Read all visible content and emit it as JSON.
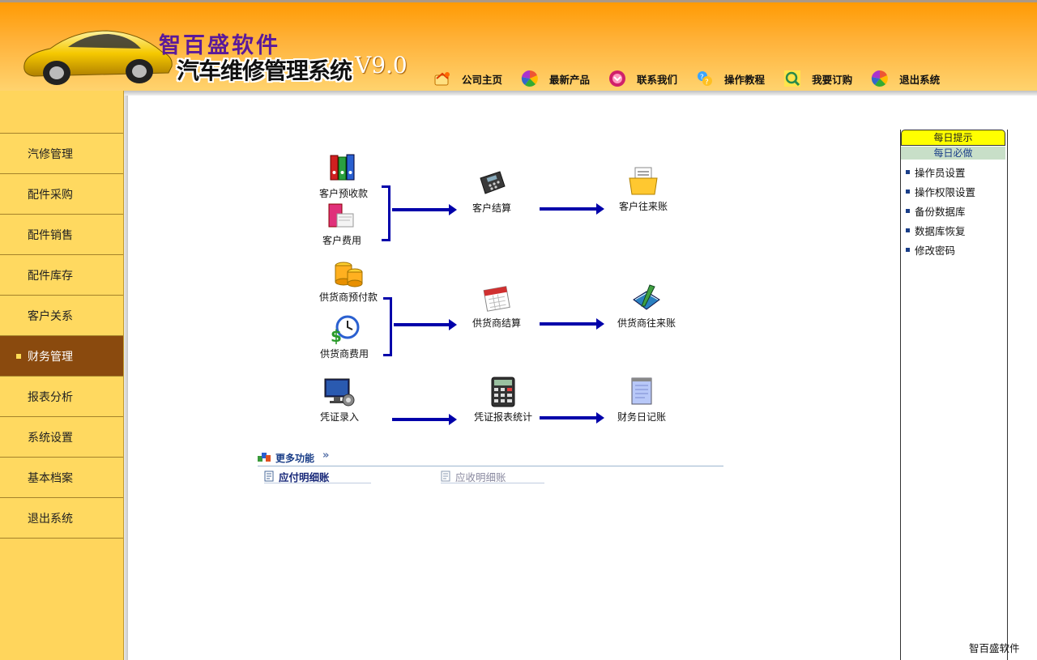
{
  "header": {
    "brand": "智百盛软件",
    "product": "汽车维修管理系统",
    "version": "V9.0",
    "nav": [
      {
        "label": "公司主页",
        "icon": "home-icon"
      },
      {
        "label": "最新产品",
        "icon": "pinwheel-icon"
      },
      {
        "label": "联系我们",
        "icon": "contact-icon"
      },
      {
        "label": "操作教程",
        "icon": "tutorial-icon"
      },
      {
        "label": "我要订购",
        "icon": "order-icon"
      },
      {
        "label": "退出系统",
        "icon": "exit-icon"
      }
    ]
  },
  "sidebar": {
    "items": [
      {
        "label": "汽修管理"
      },
      {
        "label": "配件采购"
      },
      {
        "label": "配件销售"
      },
      {
        "label": "配件库存"
      },
      {
        "label": "客户关系"
      },
      {
        "label": "财务管理",
        "active": true
      },
      {
        "label": "报表分析"
      },
      {
        "label": "系统设置"
      },
      {
        "label": "基本档案"
      },
      {
        "label": "退出系统"
      }
    ]
  },
  "flow": {
    "customer_prepay": "客户预收款",
    "customer_fee": "客户费用",
    "customer_settle": "客户结算",
    "customer_account": "客户往来账",
    "supplier_prepay": "供货商预付款",
    "supplier_fee": "供货商费用",
    "supplier_settle": "供货商结算",
    "supplier_account": "供货商往来账",
    "voucher_entry": "凭证录入",
    "voucher_report": "凭证报表统计",
    "daily_journal": "财务日记账"
  },
  "more": {
    "label": "更多功能",
    "chevron": "»",
    "links": [
      {
        "label": "应付明细账"
      },
      {
        "label": "应收明细账"
      }
    ]
  },
  "right_panel": {
    "tip_title": "每日提示",
    "must_title": "每日必做",
    "items": [
      "操作员设置",
      "操作权限设置",
      "备份数据库",
      "数据库恢复",
      "修改密码"
    ]
  },
  "footer": {
    "brand": "智百盛软件"
  },
  "colors": {
    "accent": "#0000aa",
    "sidebar": "#ffd55c",
    "active": "#8a4a0e",
    "header": "#ff9900"
  }
}
